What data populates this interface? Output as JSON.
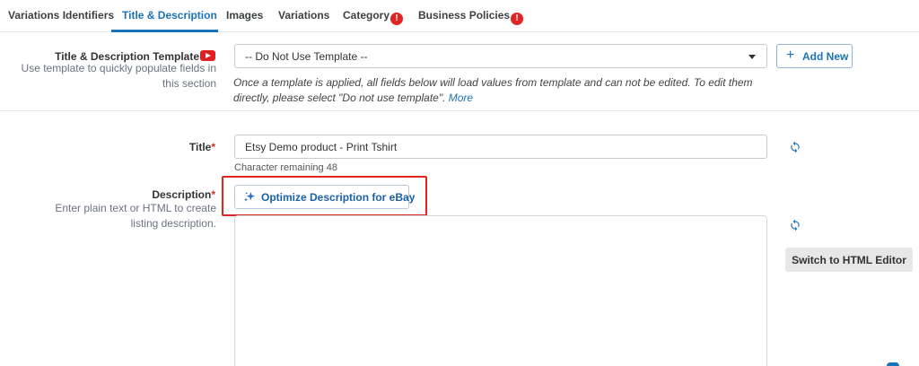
{
  "tabs": [
    {
      "label": "Variations Identifiers",
      "active": false,
      "alert": false
    },
    {
      "label": "Title & Description",
      "active": true,
      "alert": false
    },
    {
      "label": "Images",
      "active": false,
      "alert": false
    },
    {
      "label": "Variations",
      "active": false,
      "alert": false
    },
    {
      "label": "Category",
      "active": false,
      "alert": true
    },
    {
      "label": "Business Policies",
      "active": false,
      "alert": true
    }
  ],
  "alert_glyph": "!",
  "template": {
    "label": "Title & Description Template",
    "help": "Use template to quickly populate fields in this section",
    "selected": "-- Do Not Use Template --",
    "add_new_label": "Add New",
    "note": "Once a template is applied, all fields below will load values from template and can not be edited. To edit them directly, please select \"Do not use template\".",
    "more_link": "More"
  },
  "title_field": {
    "label": "Title",
    "required_mark": "*",
    "value": "Etsy Demo product - Print Tshirt",
    "char_remaining": "Character remaining 48"
  },
  "description_field": {
    "label": "Description",
    "required_mark": "*",
    "help": "Enter plain text or HTML to create listing description.",
    "optimize_label": "Optimize Description for eBay",
    "switch_editor_label": "Switch to HTML Editor"
  },
  "colors": {
    "accent": "#1a73b8",
    "alert": "#e02424",
    "highlight": "#e0251f"
  },
  "icons": [
    "youtube-icon",
    "chevron-down-icon",
    "plus-icon",
    "refresh-icon",
    "sparkle-icon"
  ]
}
